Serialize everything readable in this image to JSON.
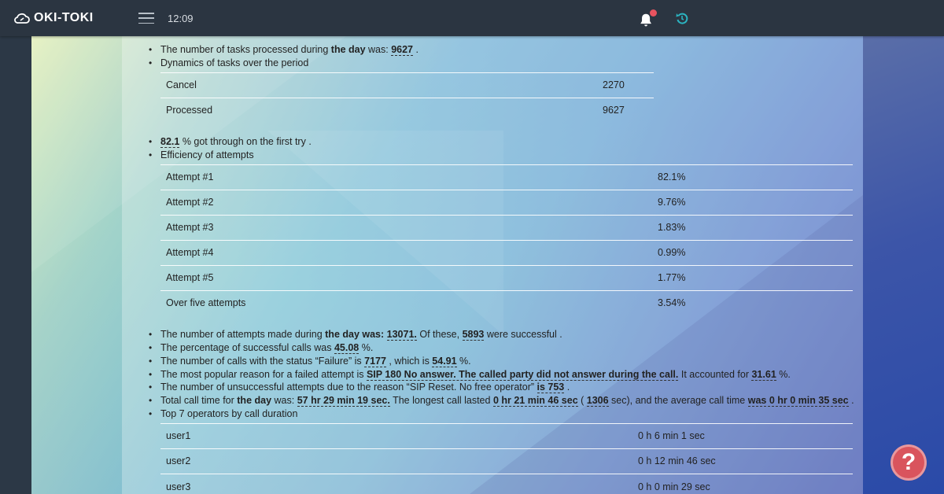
{
  "header": {
    "logo_text": "OKI-TOKI",
    "time": "12:09",
    "menu_icon": "hamburger-icon",
    "bell_icon": "bell-icon",
    "refresh_icon": "refresh-icon",
    "colors": {
      "bar": "#2b3541",
      "notification_dot": "#e8535f",
      "refresh": "#2bb3c0"
    }
  },
  "report": {
    "tasks_line": {
      "pre": "The number of tasks processed during ",
      "bold": "the day",
      "mid": " was: ",
      "value": "9627",
      "post": " ."
    },
    "dynamics_title": "Dynamics of tasks over the period",
    "dynamics": [
      {
        "label": "Cancel",
        "value": "2270"
      },
      {
        "label": "Processed",
        "value": "9627"
      }
    ],
    "first_try": {
      "value": "82.1",
      "text": " % got through on the first try ."
    },
    "efficiency_title": "Efficiency of attempts",
    "efficiency": [
      {
        "label": "Attempt #1",
        "value": "82.1%"
      },
      {
        "label": "Attempt #2",
        "value": "9.76%"
      },
      {
        "label": "Attempt #3",
        "value": "1.83%"
      },
      {
        "label": "Attempt #4",
        "value": "0.99%"
      },
      {
        "label": "Attempt #5",
        "value": "1.77%"
      },
      {
        "label": "Over five attempts",
        "value": "3.54%"
      }
    ],
    "attempts_line": {
      "pre": "The number of attempts made during ",
      "bold": "the day was:",
      "value": "13071.",
      "mid": " Of these, ",
      "value2": "5893",
      "post": " were successful ."
    },
    "percent_line": {
      "pre": "The percentage of successful calls was ",
      "value": "45.08",
      "post": " %."
    },
    "failure_line": {
      "pre": "The number of calls with the status “Failure” is ",
      "value": "7177",
      "mid": " , which is ",
      "value2": "54.91",
      "post": " %."
    },
    "reason_line": {
      "pre": "The most popular reason for a failed attempt is ",
      "value": "SIP 180 No answer. The called party did not answer during the call.",
      "mid": " It accounted for ",
      "value2": "31.61",
      "post": " %."
    },
    "reset_line": {
      "pre": "The number of unsuccessful attempts due to the reason “SIP Reset. No free operator” ",
      "value": "is 753",
      "post": " ."
    },
    "calltime_line": {
      "pre": "Total call time for ",
      "bold": "the day",
      "mid1": " was: ",
      "value": "57 hr 29 min 19 sec.",
      "mid2": " The longest call lasted ",
      "value2": "0 hr 21 min 46 sec",
      "mid3": " ( ",
      "value3": "1306",
      "mid4": " sec), and the average call time ",
      "value4": "was 0 hr 0 min 35 sec",
      "post": " ."
    },
    "operators_title": "Top 7 operators by call duration",
    "operators": [
      {
        "label": "user1",
        "value": "0 h 6 min 1 sec"
      },
      {
        "label": "user2",
        "value": "0 h 12 min 46 sec"
      },
      {
        "label": "user3",
        "value": "0 h 0 min 29 sec"
      }
    ]
  },
  "help": {
    "label": "?",
    "icon": "help-icon",
    "color": "#d9545d"
  }
}
